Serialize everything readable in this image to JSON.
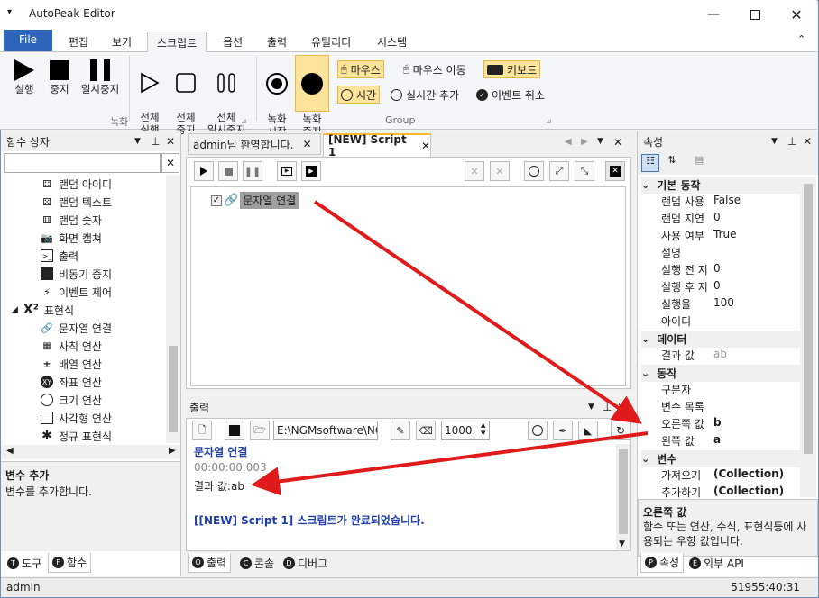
{
  "app_title": "AutoPeak Editor",
  "menu": [
    "File",
    "편집",
    "보기",
    "스크립트",
    "옵션",
    "출력",
    "유틸리티",
    "시스템"
  ],
  "ribbon": {
    "record_group": {
      "label": "녹화",
      "buttons": [
        "실행",
        "중지",
        "일시중지",
        "전체\n실행",
        "전체\n중지",
        "전체\n일시중지"
      ]
    },
    "group2": {
      "label": "Group",
      "buttons": [
        "녹화\n시작",
        "녹화\n중지"
      ],
      "small": [
        "마우스",
        "마우스 이동",
        "키보드",
        "시간",
        "실시간 추가",
        "이벤트 취소"
      ]
    }
  },
  "left_panel": {
    "title": "함수 상자",
    "items": [
      "랜덤 아이디",
      "랜덤 텍스트",
      "랜덤 숫자",
      "화면 캡쳐",
      "출력",
      "비동기 중지",
      "이벤트 제어"
    ],
    "category": "표현식",
    "sub_items": [
      "문자열 연결",
      "사칙 연산",
      "배열 연산",
      "좌표 연산",
      "크기 연산",
      "사각형 연산",
      "정규 표현식"
    ],
    "info_title": "변수 추가",
    "info_desc": "변수를 추가합니다.",
    "tabs": [
      "도구",
      "함수"
    ]
  },
  "doc_tabs": [
    "admin님 환영합니다.",
    "[NEW] Script 1"
  ],
  "script_node": "문자열 연결",
  "output": {
    "title": "출력",
    "path": "E:\\NGMsoftware\\NG",
    "count": "1000",
    "lines": [
      "문자열 연결",
      "00:00:00.003",
      "결과 값:ab",
      "",
      "[[NEW] Script 1] 스크립트가 완료되었습니다."
    ],
    "tabs": [
      "출력",
      "콘솔",
      "디버그"
    ]
  },
  "properties": {
    "title": "속성",
    "categories": [
      {
        "name": "기본 동작",
        "rows": [
          [
            "랜덤 사용",
            "False"
          ],
          [
            "랜덤 지연",
            "0"
          ],
          [
            "사용 여부",
            "True"
          ],
          [
            "설명",
            ""
          ],
          [
            "실행 전 지",
            "0"
          ],
          [
            "실행 후 지",
            "0"
          ],
          [
            "실행율",
            "100"
          ],
          [
            "아이디",
            ""
          ]
        ]
      },
      {
        "name": "데이터",
        "rows": [
          [
            "결과 값",
            "ab"
          ]
        ]
      },
      {
        "name": "동작",
        "rows": [
          [
            "구분자",
            ""
          ],
          [
            "변수 목록",
            ""
          ],
          [
            "오른쪽 값",
            "b"
          ],
          [
            "왼쪽 값",
            "a"
          ]
        ]
      },
      {
        "name": "변수",
        "rows": [
          [
            "가져오기",
            "(Collection)"
          ],
          [
            "추가하기",
            "(Collection)"
          ]
        ]
      }
    ],
    "desc_title": "오른쪽 값",
    "desc_text": "함수 또는 연산, 수식, 표현식등에 사용되는 우항 값입니다.",
    "tabs": [
      "속성",
      "외부 API"
    ]
  },
  "status": {
    "user": "admin",
    "time": "51955:40:31"
  },
  "colors": {
    "accent": "#2b64b8",
    "highlight": "#fde49a",
    "arrow": "#e01b1b",
    "output_blue": "#1f3ea8"
  }
}
